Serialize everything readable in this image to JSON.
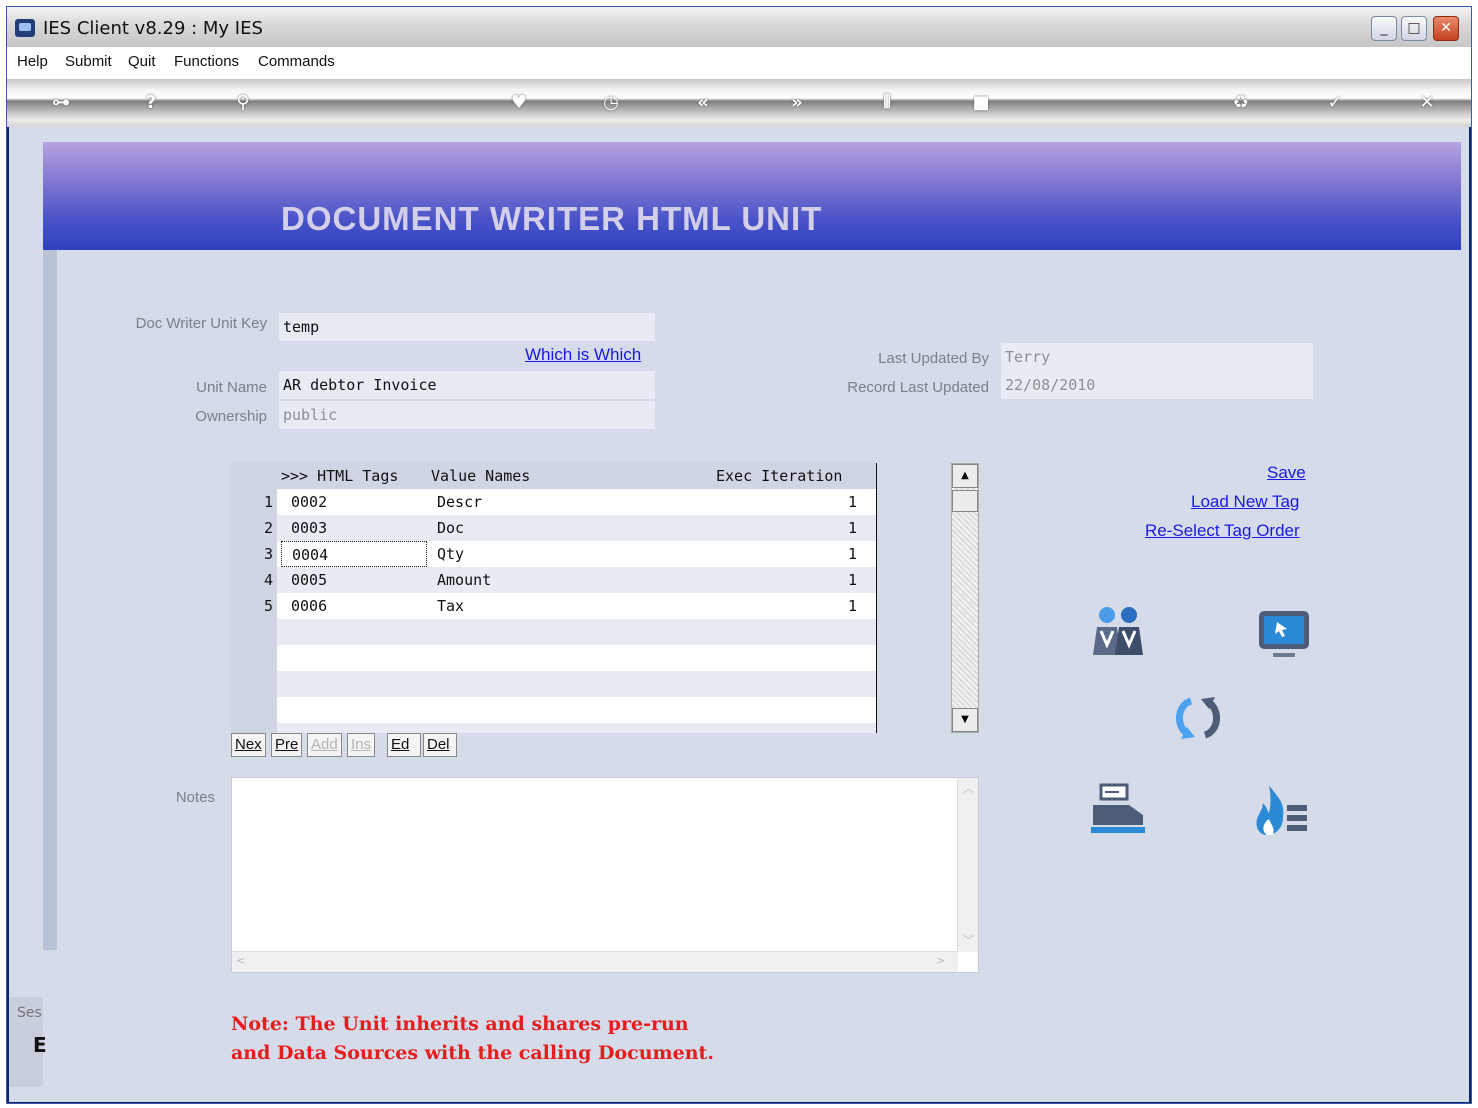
{
  "window": {
    "title": "IES Client v8.29 : My IES"
  },
  "menu": [
    "Help",
    "Submit",
    "Quit",
    "Functions",
    "Commands"
  ],
  "toolbar_icons": [
    "key-icon",
    "help-icon",
    "search-icon",
    "heart-icon",
    "clock-icon",
    "rewind-icon",
    "forward-icon",
    "columns-icon",
    "stop-icon",
    "recycle-icon",
    "check-icon",
    "close-icon"
  ],
  "banner": {
    "title": "DOCUMENT WRITER HTML UNIT"
  },
  "form": {
    "unit_key_label": "Doc Writer Unit Key",
    "unit_key_value": "temp",
    "which_is_which": "Which is Which",
    "unit_name_label": "Unit Name",
    "unit_name_value": "AR debtor Invoice",
    "ownership_label": "Ownership",
    "ownership_value": "public",
    "last_updated_by_label": "Last Updated By",
    "last_updated_by_value": "Terry",
    "record_last_updated_label": "Record Last Updated",
    "record_last_updated_value": "22/08/2010"
  },
  "grid": {
    "headers": {
      "tags": ">>> HTML Tags",
      "values": "Value Names",
      "exec": "Exec Iteration"
    },
    "rows": [
      {
        "num": "1",
        "tag": "0002",
        "value": "Descr",
        "exec": "1"
      },
      {
        "num": "2",
        "tag": "0003",
        "value": "Doc",
        "exec": "1"
      },
      {
        "num": "3",
        "tag": "0004",
        "value": "Qty",
        "exec": "1"
      },
      {
        "num": "4",
        "tag": "0005",
        "value": "Amount",
        "exec": "1"
      },
      {
        "num": "5",
        "tag": "0006",
        "value": "Tax",
        "exec": "1"
      }
    ]
  },
  "nav_buttons": {
    "next": "Nex",
    "prev": "Pre",
    "add": "Add",
    "ins": "Ins",
    "edit": "Ed",
    "del": "Del"
  },
  "actions": {
    "save": "Save",
    "load_new_tag": "Load New Tag",
    "reselect_tag_order": "Re-Select Tag Order"
  },
  "notes": {
    "label": "Notes",
    "value": ""
  },
  "note_text": {
    "line1": "Note: The Unit inherits and shares pre-run",
    "line2": "and Data Sources with the calling Document."
  },
  "statusbar": {
    "se": "Ses",
    "e": "E"
  },
  "colors": {
    "accent": "#2f41c0",
    "note": "#e51d1d",
    "link": "#1a1ae0"
  }
}
